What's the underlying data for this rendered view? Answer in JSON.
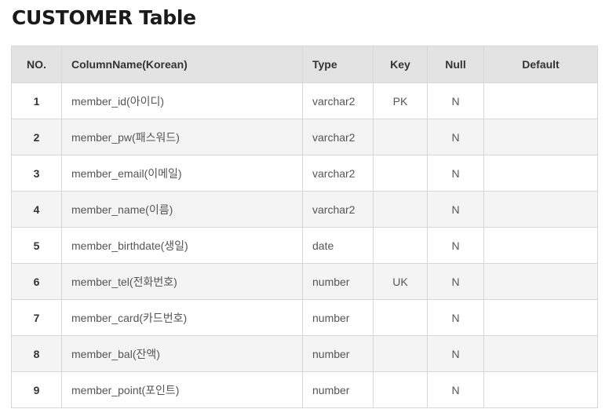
{
  "title": "CUSTOMER Table",
  "table": {
    "headers": {
      "no": "NO.",
      "column": "ColumnName(Korean)",
      "type": "Type",
      "key": "Key",
      "null": "Null",
      "default": "Default"
    },
    "rows": [
      {
        "no": "1",
        "column": "member_id(아이디)",
        "type": "varchar2",
        "key": "PK",
        "null": "N",
        "default": ""
      },
      {
        "no": "2",
        "column": "member_pw(패스워드)",
        "type": "varchar2",
        "key": "",
        "null": "N",
        "default": ""
      },
      {
        "no": "3",
        "column": "member_email(이메일)",
        "type": "varchar2",
        "key": "",
        "null": "N",
        "default": ""
      },
      {
        "no": "4",
        "column": "member_name(이름)",
        "type": "varchar2",
        "key": "",
        "null": "N",
        "default": ""
      },
      {
        "no": "5",
        "column": "member_birthdate(생일)",
        "type": "date",
        "key": "",
        "null": "N",
        "default": ""
      },
      {
        "no": "6",
        "column": "member_tel(전화번호)",
        "type": "number",
        "key": "UK",
        "null": "N",
        "default": ""
      },
      {
        "no": "7",
        "column": "member_card(카드번호)",
        "type": "number",
        "key": "",
        "null": "N",
        "default": ""
      },
      {
        "no": "8",
        "column": "member_bal(잔액)",
        "type": "number",
        "key": "",
        "null": "N",
        "default": ""
      },
      {
        "no": "9",
        "column": "member_point(포인트)",
        "type": "number",
        "key": "",
        "null": "N",
        "default": ""
      }
    ]
  }
}
